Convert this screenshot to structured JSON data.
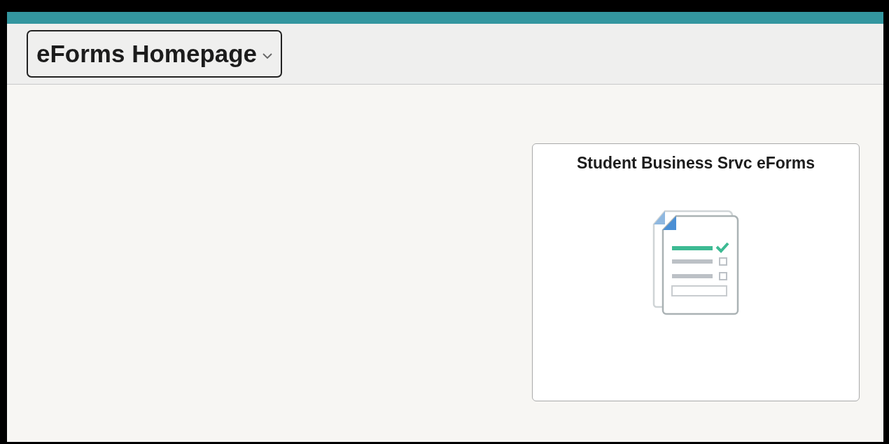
{
  "header": {
    "title": "eForms Homepage"
  },
  "tiles": [
    {
      "title": "Student Business Srvc eForms"
    }
  ]
}
